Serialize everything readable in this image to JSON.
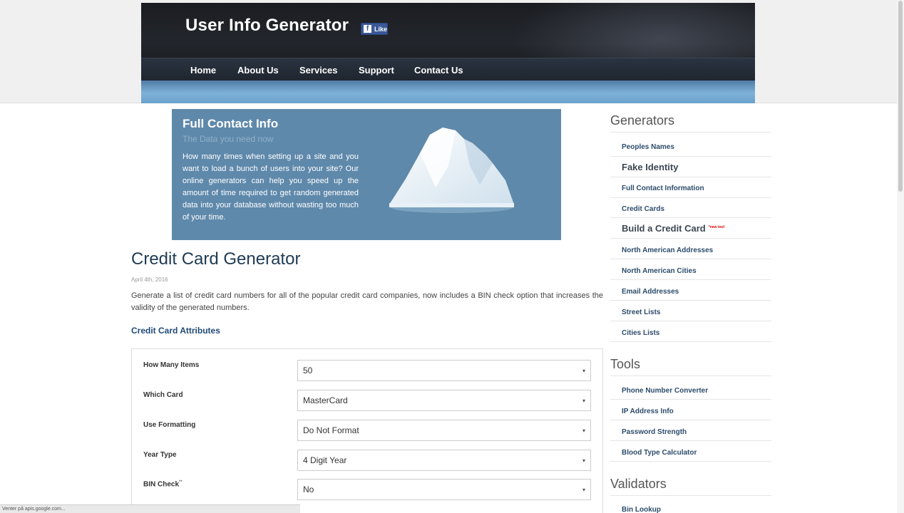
{
  "header": {
    "site_title": "User Info Generator",
    "fb_like": "Like",
    "nav": [
      "Home",
      "About Us",
      "Services",
      "Support",
      "Contact Us"
    ]
  },
  "hero": {
    "title": "Full Contact Info",
    "subtitle": "The Data you need now",
    "text": "How many times when setting up a site and you want to load a bunch of users into your site? Our online generators can help you speed up the amount of time required to get random generated data into your database without wasting too much of your time."
  },
  "main": {
    "title": "Credit Card Generator",
    "date": "April 4th, 2016",
    "description": "Generate a list of credit card numbers for all of the popular credit card companies, now includes a BIN check option that increases the validity of the generated numbers.",
    "section_title": "Credit Card Attributes",
    "form": [
      {
        "label": "How Many Items",
        "value": "50"
      },
      {
        "label": "Which Card",
        "value": "MasterCard"
      },
      {
        "label": "Use Formatting",
        "value": "Do Not Format"
      },
      {
        "label": "Year Type",
        "value": "4 Digit Year"
      },
      {
        "label": "BIN Check",
        "sup": "**",
        "value": "No"
      }
    ]
  },
  "sidebar": {
    "generators_title": "Generators",
    "generators": [
      "Peoples Names",
      "Fake Identity",
      "Full Contact Information",
      "Credit Cards",
      "Build a Credit Card",
      "North American Addresses",
      "North American Cities",
      "Email Addresses",
      "Street Lists",
      "Cities Lists"
    ],
    "new_badge": "*new tool",
    "tools_title": "Tools",
    "tools": [
      "Phone Number Converter",
      "IP Address Info",
      "Password Strength",
      "Blood Type Calculator"
    ],
    "validators_title": "Validators",
    "validators": [
      "Bin Lookup"
    ]
  },
  "status": {
    "text": "Venter på apis.google.com..."
  },
  "colors": {
    "hero_bg": "#5f89ab",
    "title_blue": "#1f3b54",
    "link_blue": "#2c4c6b",
    "header_dark": "#1b1d22"
  }
}
